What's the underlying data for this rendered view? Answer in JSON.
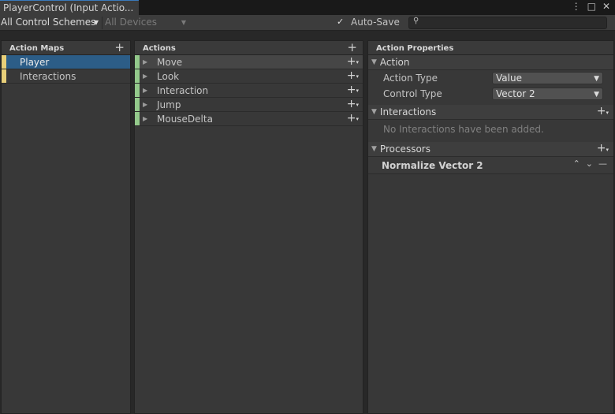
{
  "window": {
    "tab_title": "PlayerControl (Input Actio...",
    "icons": [
      "kebab-icon",
      "maximize-icon",
      "close-icon"
    ]
  },
  "toolbar": {
    "control_schemes": "All Control Schemes",
    "devices": "All Devices",
    "autosave_label": "Auto-Save",
    "autosave_checked": true,
    "search_value": ""
  },
  "action_maps": {
    "header": "Action Maps",
    "items": [
      {
        "label": "Player",
        "selected": true
      },
      {
        "label": "Interactions",
        "selected": false
      }
    ]
  },
  "actions": {
    "header": "Actions",
    "items": [
      {
        "label": "Move"
      },
      {
        "label": "Look"
      },
      {
        "label": "Interaction"
      },
      {
        "label": "Jump"
      },
      {
        "label": "MouseDelta"
      }
    ]
  },
  "properties": {
    "header": "Action Properties",
    "action_section": "Action",
    "action_type_label": "Action Type",
    "action_type_value": "Value",
    "control_type_label": "Control Type",
    "control_type_value": "Vector 2",
    "interactions_section": "Interactions",
    "interactions_empty": "No Interactions have been added.",
    "processors_section": "Processors",
    "processor_item": "Normalize Vector 2"
  },
  "colors": {
    "selection": "#2c5d87",
    "map_stripe": "#e8cf79",
    "action_stripe": "#93c98b",
    "tab_accent": "#3a79bb"
  }
}
